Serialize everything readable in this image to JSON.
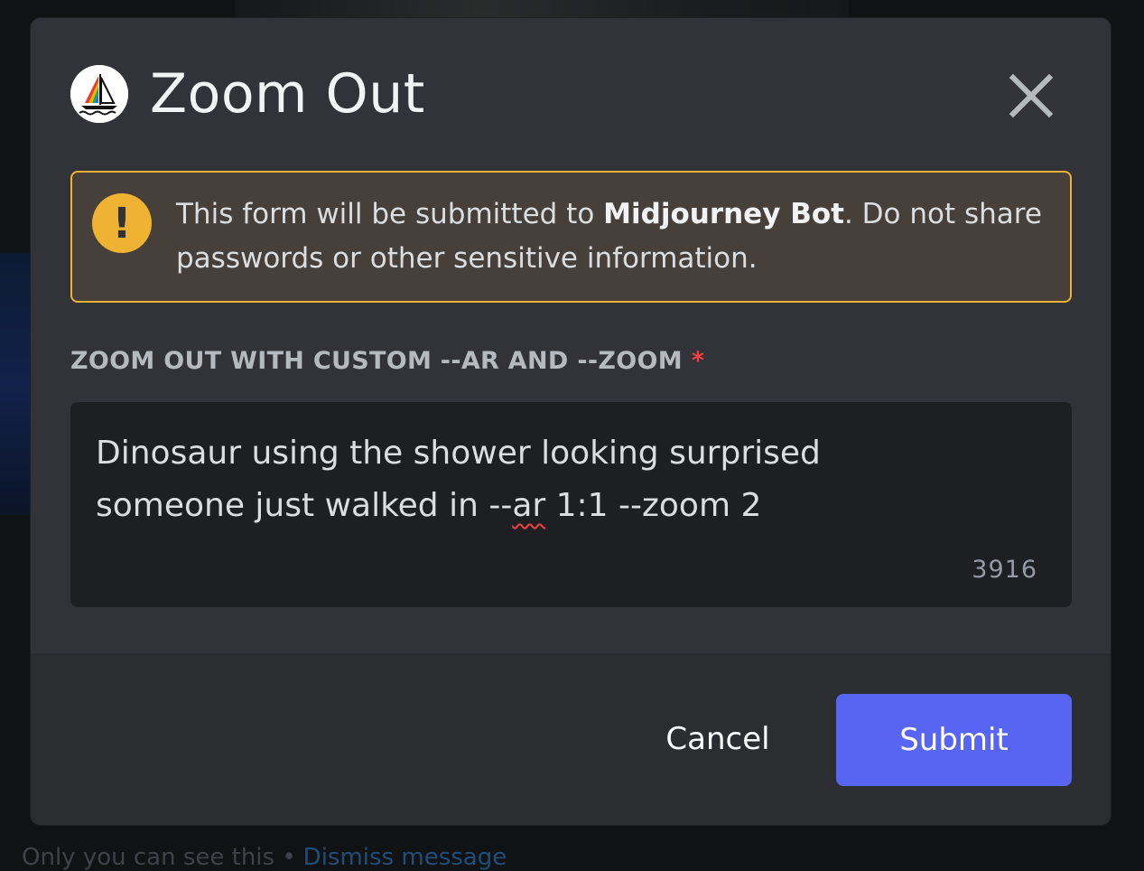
{
  "modal": {
    "title": "Zoom Out",
    "bot_avatar_icon": "midjourney-sailboat-logo",
    "close_icon": "close-icon"
  },
  "warning": {
    "icon": "exclamation-icon",
    "text_before": "This form will be submitted to ",
    "bot_name": "Midjourney Bot",
    "text_after": ". Do not share passwords or other sensitive information."
  },
  "field": {
    "label": "ZOOM OUT WITH CUSTOM --AR AND --ZOOM",
    "required_marker": "*",
    "value_before": "Dinosaur using the shower looking surprised\nsomeone just walked in --",
    "value_misspelled": "ar",
    "value_after": " 1:1 --zoom 2",
    "char_count": "3916"
  },
  "footer": {
    "cancel_label": "Cancel",
    "submit_label": "Submit"
  },
  "background": {
    "notice_text": "Only you can see this •",
    "dismiss_link": "Dismiss message"
  },
  "colors": {
    "modal_bg": "#313338",
    "footer_bg": "#2b2d31",
    "warning_border": "#f0b232",
    "warning_bg": "#47403a",
    "input_bg": "#1e1f22",
    "primary_button": "#5865f2",
    "required": "#f23f43"
  }
}
